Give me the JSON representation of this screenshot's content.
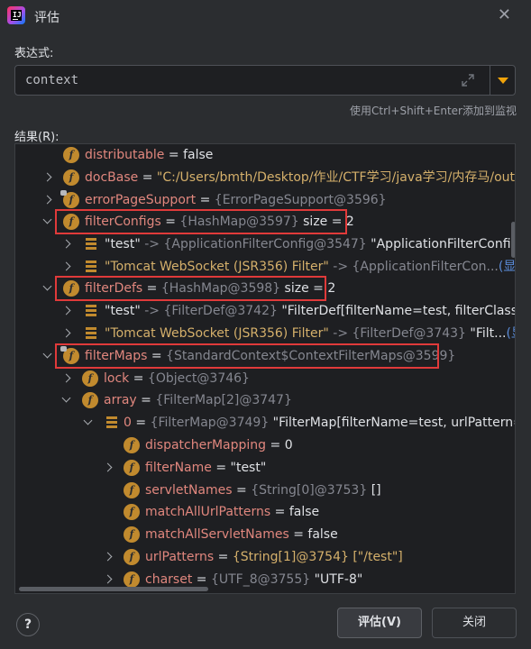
{
  "window": {
    "title": "评估"
  },
  "expression": {
    "label": "表达式:",
    "value": "context"
  },
  "hint": "使用Ctrl+Shift+Enter添加到监视",
  "results": {
    "label": "结果(R):"
  },
  "tree": [
    {
      "name": "distributable",
      "eq": " = ",
      "val": "false",
      "vc": "w"
    },
    {
      "name": "docBase",
      "eq": " = ",
      "val": "\"C:/Users/bmth/Desktop/作业/CTF学习/java学习/内存马/out/a",
      "vc": "s"
    },
    {
      "name": "errorPageSupport",
      "eq": " = ",
      "type": "{ErrorPageSupport@3596}"
    },
    {
      "name": "filterConfigs",
      "eq": " = ",
      "type": "{HashMap@3597}",
      "extra": "  size = 2"
    },
    {
      "name": "\"test\"",
      "arrow": " -> ",
      "type": "{ApplicationFilterConfig@3547}",
      "extra": " \"ApplicationFilterConfig[na"
    },
    {
      "name": "\"Tomcat WebSocket (JSR356) Filter\"",
      "arrow": " -> ",
      "type": "{ApplicationFilterCon...",
      "link": "(显示)"
    },
    {
      "name": "filterDefs",
      "eq": " = ",
      "type": "{HashMap@3598}",
      "extra": "  size = 2"
    },
    {
      "name": "\"test\"",
      "arrow": " -> ",
      "type": "{FilterDef@3742}",
      "extra": " \"FilterDef[filterName=test, filterClass=filte"
    },
    {
      "name": "\"Tomcat WebSocket (JSR356) Filter\"",
      "arrow": " -> ",
      "type": "{FilterDef@3743}",
      "extra": " \"Filt...",
      "link": "(显示)"
    },
    {
      "name": "filterMaps",
      "eq": " = ",
      "type": "{StandardContext$ContextFilterMaps@3599}"
    },
    {
      "name": "lock",
      "eq": " = ",
      "type": "{Object@3746}"
    },
    {
      "name": "array",
      "eq": " = ",
      "type": "{FilterMap[2]@3747}"
    },
    {
      "name": "0",
      "eq": " = ",
      "type": "{FilterMap@3749}",
      "extra": " \"FilterMap[filterName=test, urlPattern=/tes"
    },
    {
      "name": "dispatcherMapping",
      "eq": " = ",
      "val": "0",
      "vc": "w"
    },
    {
      "name": "filterName",
      "eq": " = ",
      "val": "\"test\"",
      "vc": "w"
    },
    {
      "name": "servletNames",
      "eq": " = ",
      "type": "{String[0]@3753}",
      "extra": " []"
    },
    {
      "name": "matchAllUrlPatterns",
      "eq": " = ",
      "val": "false",
      "vc": "w"
    },
    {
      "name": "matchAllServletNames",
      "eq": " = ",
      "val": "false",
      "vc": "w"
    },
    {
      "name": "urlPatterns",
      "eq": " = ",
      "val": "{String[1]@3754} [\"/test\"]",
      "vc": "s"
    },
    {
      "name": "charset",
      "eq": " = ",
      "type": "{UTF_8@3755}",
      "extra": " \"UTF-8\""
    }
  ],
  "buttons": {
    "evaluate": "评估(V)",
    "close": "关闭"
  },
  "help_label": "?",
  "colors": {
    "accent_dropdown": "#f0a30a",
    "field_icon": "#c18a2e",
    "highlight_box": "#e03a3a",
    "name": "#e1877e",
    "link": "#5b8cd9"
  }
}
